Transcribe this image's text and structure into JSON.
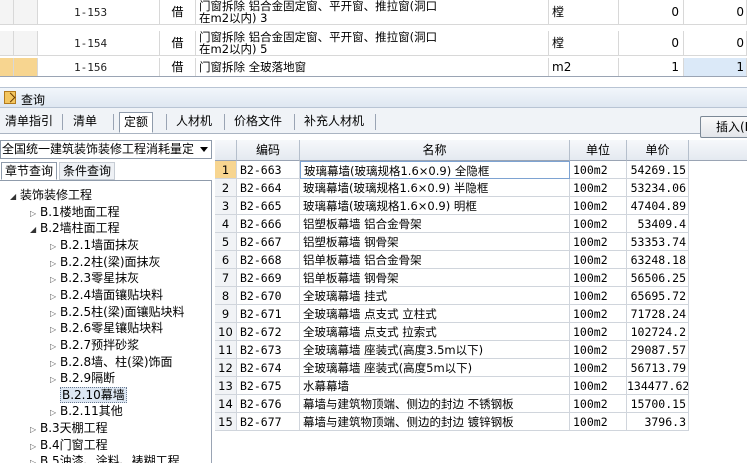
{
  "top_grid": {
    "rows": [
      {
        "code": "1-153",
        "type": "借",
        "name_line1": "门窗拆除 铝合金固定窗、平开窗、推拉窗(洞口",
        "name_line2": "在m2以内) 3",
        "unit": "樘",
        "qty": "0",
        "qty2": "0"
      },
      {
        "code": "1-154",
        "type": "借",
        "name_line1": "门窗拆除 铝合金固定窗、平开窗、推拉窗(洞口",
        "name_line2": "在m2以内) 5",
        "unit": "樘",
        "qty": "0",
        "qty2": "0"
      },
      {
        "code": "1-156",
        "type": "借",
        "name_line1": "门窗拆除 全玻落地窗",
        "name_line2": "",
        "unit": "m2",
        "qty": "1",
        "qty2": "1"
      }
    ]
  },
  "query_panel": {
    "title": "查询",
    "tabs": [
      "清单指引",
      "清单",
      "定额",
      "人材机",
      "价格文件",
      "补充人材机"
    ],
    "active_tab": "定额",
    "insert_button": "插入(I)",
    "library_select": "全国统一建筑装饰装修工程消耗量定",
    "subtabs": [
      "章节查询",
      "条件查询"
    ]
  },
  "tree": [
    {
      "label": "装饰装修工程",
      "arrow": "◢",
      "indent": 0
    },
    {
      "label": "B.1楼地面工程",
      "arrow": "▷",
      "indent": 1
    },
    {
      "label": "B.2墙柱面工程",
      "arrow": "◢",
      "indent": 1
    },
    {
      "label": "B.2.1墙面抹灰",
      "arrow": "▷",
      "indent": 2
    },
    {
      "label": "B.2.2柱(梁)面抹灰",
      "arrow": "▷",
      "indent": 2
    },
    {
      "label": "B.2.3零星抹灰",
      "arrow": "▷",
      "indent": 2
    },
    {
      "label": "B.2.4墙面镶贴块料",
      "arrow": "▷",
      "indent": 2
    },
    {
      "label": "B.2.5柱(梁)面镶贴块料",
      "arrow": "▷",
      "indent": 2
    },
    {
      "label": "B.2.6零星镶贴块料",
      "arrow": "▷",
      "indent": 2
    },
    {
      "label": "B.2.7预拌砂浆",
      "arrow": "▷",
      "indent": 2
    },
    {
      "label": "B.2.8墙、柱(梁)饰面",
      "arrow": "▷",
      "indent": 2
    },
    {
      "label": "B.2.9隔断",
      "arrow": "▷",
      "indent": 2
    },
    {
      "label": "B.2.10幕墙",
      "arrow": "",
      "indent": 2,
      "selected": true
    },
    {
      "label": "B.2.11其他",
      "arrow": "▷",
      "indent": 2
    },
    {
      "label": "B.3天棚工程",
      "arrow": "▷",
      "indent": 1
    },
    {
      "label": "B.4门窗工程",
      "arrow": "▷",
      "indent": 1
    },
    {
      "label": "B.5油漆、涂料、裱糊工程",
      "arrow": "▷",
      "indent": 1
    }
  ],
  "grid": {
    "headers": {
      "code": "编码",
      "name": "名称",
      "unit": "单位",
      "price": "单价"
    },
    "rows": [
      {
        "no": "1",
        "code": "B2-663",
        "name": "玻璃幕墙(玻璃规格1.6×0.9) 全隐框",
        "unit": "100m2",
        "price": "54269.15"
      },
      {
        "no": "2",
        "code": "B2-664",
        "name": "玻璃幕墙(玻璃规格1.6×0.9) 半隐框",
        "unit": "100m2",
        "price": "53234.06"
      },
      {
        "no": "3",
        "code": "B2-665",
        "name": "玻璃幕墙(玻璃规格1.6×0.9) 明框",
        "unit": "100m2",
        "price": "47404.89"
      },
      {
        "no": "4",
        "code": "B2-666",
        "name": "铝塑板幕墙 铝合金骨架",
        "unit": "100m2",
        "price": "53409.4"
      },
      {
        "no": "5",
        "code": "B2-667",
        "name": "铝塑板幕墙 钢骨架",
        "unit": "100m2",
        "price": "53353.74"
      },
      {
        "no": "6",
        "code": "B2-668",
        "name": "铝单板幕墙 铝合金骨架",
        "unit": "100m2",
        "price": "63248.18"
      },
      {
        "no": "7",
        "code": "B2-669",
        "name": "铝单板幕墙 钢骨架",
        "unit": "100m2",
        "price": "56506.25"
      },
      {
        "no": "8",
        "code": "B2-670",
        "name": "全玻璃幕墙 挂式",
        "unit": "100m2",
        "price": "65695.72"
      },
      {
        "no": "9",
        "code": "B2-671",
        "name": "全玻璃幕墙 点支式 立柱式",
        "unit": "100m2",
        "price": "71728.24"
      },
      {
        "no": "10",
        "code": "B2-672",
        "name": "全玻璃幕墙 点支式 拉索式",
        "unit": "100m2",
        "price": "102724.2"
      },
      {
        "no": "11",
        "code": "B2-673",
        "name": "全玻璃幕墙 座装式(高度3.5m以下)",
        "unit": "100m2",
        "price": "29087.57"
      },
      {
        "no": "12",
        "code": "B2-674",
        "name": "全玻璃幕墙 座装式(高度5m以下)",
        "unit": "100m2",
        "price": "56713.79"
      },
      {
        "no": "13",
        "code": "B2-675",
        "name": "水幕幕墙",
        "unit": "100m2",
        "price": "134477.62"
      },
      {
        "no": "14",
        "code": "B2-676",
        "name": "幕墙与建筑物顶端、侧边的封边 不锈钢板",
        "unit": "100m2",
        "price": "15700.15"
      },
      {
        "no": "15",
        "code": "B2-677",
        "name": "幕墙与建筑物顶端、侧边的封边 镀锌钢板",
        "unit": "100m2",
        "price": "3796.3"
      }
    ]
  }
}
